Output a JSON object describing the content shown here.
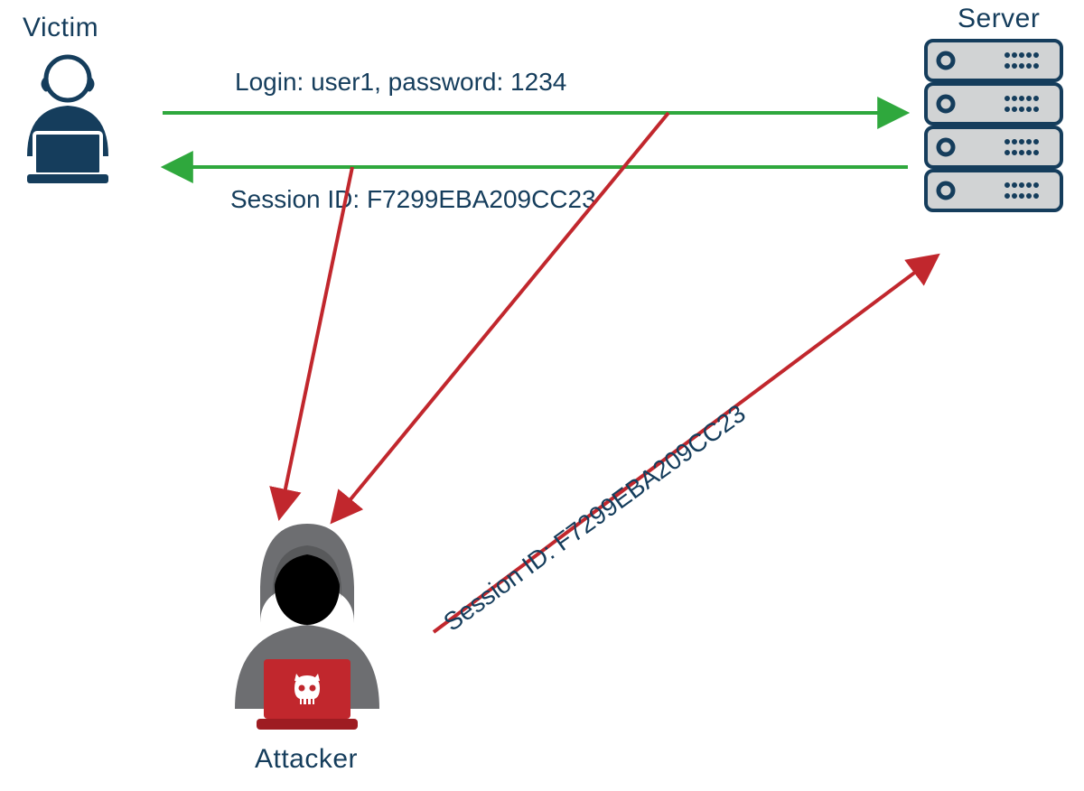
{
  "labels": {
    "victim": "Victim",
    "server": "Server",
    "attacker": "Attacker"
  },
  "messages": {
    "login": "Login: user1, password: 1234",
    "session_response": "Session ID: F7299EBA209CC23",
    "hijack": "Session ID: F7299EBA209CC23"
  },
  "colors": {
    "navy": "#153d5c",
    "green": "#2fa83d",
    "red": "#c1272d",
    "grey": "#6d6e71",
    "servergrey": "#d1d3d4"
  }
}
